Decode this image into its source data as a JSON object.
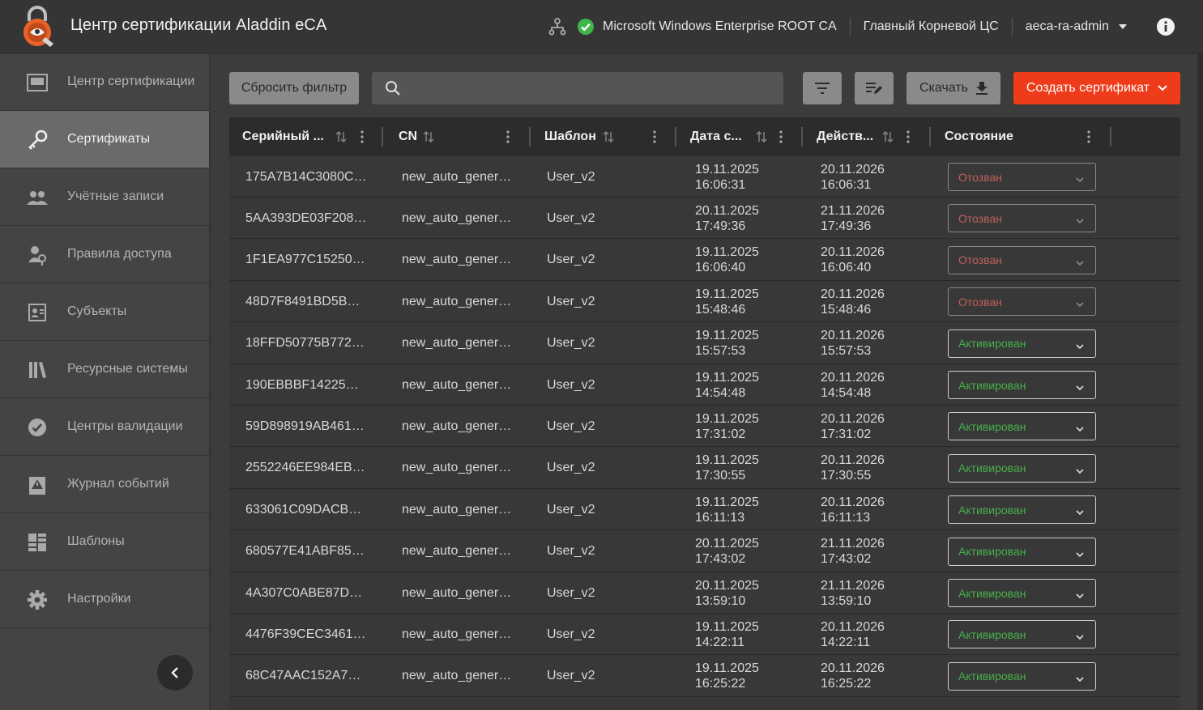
{
  "header": {
    "title": "Центр сертификации Aladdin eCA",
    "ca_name": "Microsoft Windows Enterprise ROOT CA",
    "root_ca": "Главный Корневой ЦС",
    "user": "aeca-ra-admin",
    "status_color": "#3fb54a"
  },
  "sidebar": {
    "items": [
      {
        "label": "Центр сертификации",
        "icon": "ca-center-icon"
      },
      {
        "label": "Сертификаты",
        "icon": "key-icon"
      },
      {
        "label": "Учётные записи",
        "icon": "users-icon"
      },
      {
        "label": "Правила доступа",
        "icon": "user-key-icon"
      },
      {
        "label": "Субъекты",
        "icon": "id-card-icon"
      },
      {
        "label": "Ресурсные системы",
        "icon": "library-icon"
      },
      {
        "label": "Центры валидации",
        "icon": "check-badge-icon"
      },
      {
        "label": "Журнал событий",
        "icon": "log-icon"
      },
      {
        "label": "Шаблоны",
        "icon": "templates-icon"
      },
      {
        "label": "Настройки",
        "icon": "gear-icon"
      }
    ],
    "active_index": 1
  },
  "toolbar": {
    "reset_filter": "Сбросить фильтр",
    "search_placeholder": "",
    "download": "Скачать",
    "create": "Создать сертификат",
    "accent_color": "#ee3b1a"
  },
  "table": {
    "columns": [
      "Серийный ...",
      "CN",
      "Шаблон",
      "Дата с...",
      "Действ...",
      "Состояние"
    ],
    "rows": [
      {
        "serial": "175A7B14C3080C…",
        "cn": "new_auto_gener…",
        "template": "User_v2",
        "from_date": "19.11.2025",
        "from_time": "16:06:31",
        "to_date": "20.11.2026",
        "to_time": "16:06:31",
        "status": "Отозван",
        "kind": "revoked"
      },
      {
        "serial": "5AA393DE03F208…",
        "cn": "new_auto_gener…",
        "template": "User_v2",
        "from_date": "20.11.2025",
        "from_time": "17:49:36",
        "to_date": "21.11.2026",
        "to_time": "17:49:36",
        "status": "Отозван",
        "kind": "revoked"
      },
      {
        "serial": "1F1EA977C15250…",
        "cn": "new_auto_gener…",
        "template": "User_v2",
        "from_date": "19.11.2025",
        "from_time": "16:06:40",
        "to_date": "20.11.2026",
        "to_time": "16:06:40",
        "status": "Отозван",
        "kind": "revoked"
      },
      {
        "serial": "48D7F8491BD5B…",
        "cn": "new_auto_gener…",
        "template": "User_v2",
        "from_date": "19.11.2025",
        "from_time": "15:48:46",
        "to_date": "20.11.2026",
        "to_time": "15:48:46",
        "status": "Отозван",
        "kind": "revoked"
      },
      {
        "serial": "18FFD50775B772…",
        "cn": "new_auto_gener…",
        "template": "User_v2",
        "from_date": "19.11.2025",
        "from_time": "15:57:53",
        "to_date": "20.11.2026",
        "to_time": "15:57:53",
        "status": "Активирован",
        "kind": "active"
      },
      {
        "serial": "190EBBBF14225…",
        "cn": "new_auto_gener…",
        "template": "User_v2",
        "from_date": "19.11.2025",
        "from_time": "14:54:48",
        "to_date": "20.11.2026",
        "to_time": "14:54:48",
        "status": "Активирован",
        "kind": "active"
      },
      {
        "serial": "59D898919AB461…",
        "cn": "new_auto_gener…",
        "template": "User_v2",
        "from_date": "19.11.2025",
        "from_time": "17:31:02",
        "to_date": "20.11.2026",
        "to_time": "17:31:02",
        "status": "Активирован",
        "kind": "active"
      },
      {
        "serial": "2552246EE984EB…",
        "cn": "new_auto_gener…",
        "template": "User_v2",
        "from_date": "19.11.2025",
        "from_time": "17:30:55",
        "to_date": "20.11.2026",
        "to_time": "17:30:55",
        "status": "Активирован",
        "kind": "active"
      },
      {
        "serial": "633061C09DACB…",
        "cn": "new_auto_gener…",
        "template": "User_v2",
        "from_date": "19.11.2025",
        "from_time": "16:11:13",
        "to_date": "20.11.2026",
        "to_time": "16:11:13",
        "status": "Активирован",
        "kind": "active"
      },
      {
        "serial": "680577E41ABF85…",
        "cn": "new_auto_gener…",
        "template": "User_v2",
        "from_date": "20.11.2025",
        "from_time": "17:43:02",
        "to_date": "21.11.2026",
        "to_time": "17:43:02",
        "status": "Активирован",
        "kind": "active"
      },
      {
        "serial": "4A307C0ABE87D…",
        "cn": "new_auto_gener…",
        "template": "User_v2",
        "from_date": "20.11.2025",
        "from_time": "13:59:10",
        "to_date": "21.11.2026",
        "to_time": "13:59:10",
        "status": "Активирован",
        "kind": "active"
      },
      {
        "serial": "4476F39CEC3461…",
        "cn": "new_auto_gener…",
        "template": "User_v2",
        "from_date": "19.11.2025",
        "from_time": "14:22:11",
        "to_date": "20.11.2026",
        "to_time": "14:22:11",
        "status": "Активирован",
        "kind": "active"
      },
      {
        "serial": "68C47AAC152A7…",
        "cn": "new_auto_gener…",
        "template": "User_v2",
        "from_date": "19.11.2025",
        "from_time": "16:25:22",
        "to_date": "20.11.2026",
        "to_time": "16:25:22",
        "status": "Активирован",
        "kind": "active"
      }
    ]
  }
}
